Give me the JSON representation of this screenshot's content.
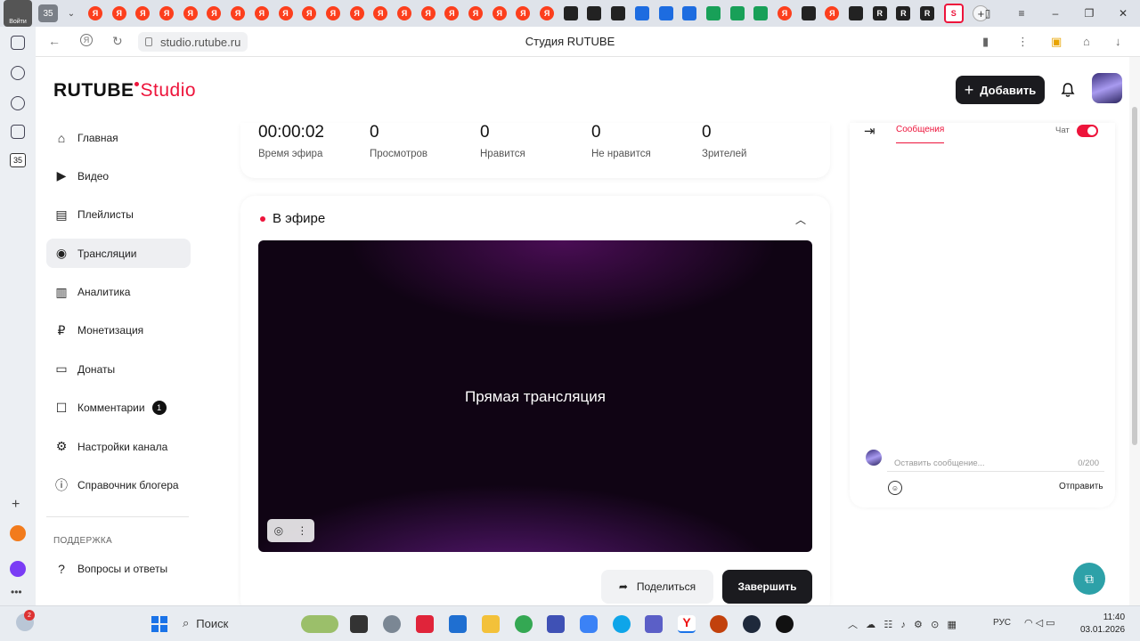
{
  "browser": {
    "tab_counter": "35",
    "address": "studio.rutube.ru",
    "page_title": "Студия RUTUBE",
    "profile_label": "Войти",
    "sidebar_badge": "35"
  },
  "header": {
    "logo_main": "RUTUBE",
    "logo_studio": "Studio",
    "add_label": "Добавить"
  },
  "nav": {
    "items": [
      {
        "label": "Главная",
        "icon": "home-icon"
      },
      {
        "label": "Видео",
        "icon": "video-icon"
      },
      {
        "label": "Плейлисты",
        "icon": "playlist-icon"
      },
      {
        "label": "Трансляции",
        "icon": "broadcast-icon"
      },
      {
        "label": "Аналитика",
        "icon": "analytics-icon"
      },
      {
        "label": "Монетизация",
        "icon": "ruble-icon"
      },
      {
        "label": "Донаты",
        "icon": "wallet-icon"
      },
      {
        "label": "Комментарии",
        "icon": "comment-icon",
        "badge": "1"
      },
      {
        "label": "Настройки канала",
        "icon": "gear-icon"
      },
      {
        "label": "Справочник блогера",
        "icon": "info-icon"
      }
    ],
    "active_index": 3,
    "support_title": "ПОДДЕРЖКА",
    "support_item": "Вопросы и ответы"
  },
  "stats": {
    "airtime_value": "00:00:02",
    "airtime_label": "Время эфира",
    "views_value": "0",
    "views_label": "Просмотров",
    "likes_value": "0",
    "likes_label": "Нравится",
    "dislikes_value": "0",
    "dislikes_label": "Не нравится",
    "viewers_value": "0",
    "viewers_label": "Зрителей"
  },
  "live": {
    "status_label": "В эфире",
    "player_title": "Прямая трансляция",
    "share_label": "Поделиться",
    "end_label": "Завершить"
  },
  "chat": {
    "tab_label": "Сообщения",
    "toggle_label": "Чат",
    "toggle_on": true,
    "input_placeholder": "Оставить сообщение...",
    "char_count": "0/200",
    "send_label": "Отправить"
  },
  "taskbar": {
    "search_label": "Поиск",
    "weather_badge": "2",
    "lang": "РУС",
    "time": "11:40",
    "date": "03.01.2026"
  },
  "colors": {
    "accent": "#ed143b",
    "dark_button": "#1b1b1f",
    "help_fab": "#2da1a8"
  }
}
